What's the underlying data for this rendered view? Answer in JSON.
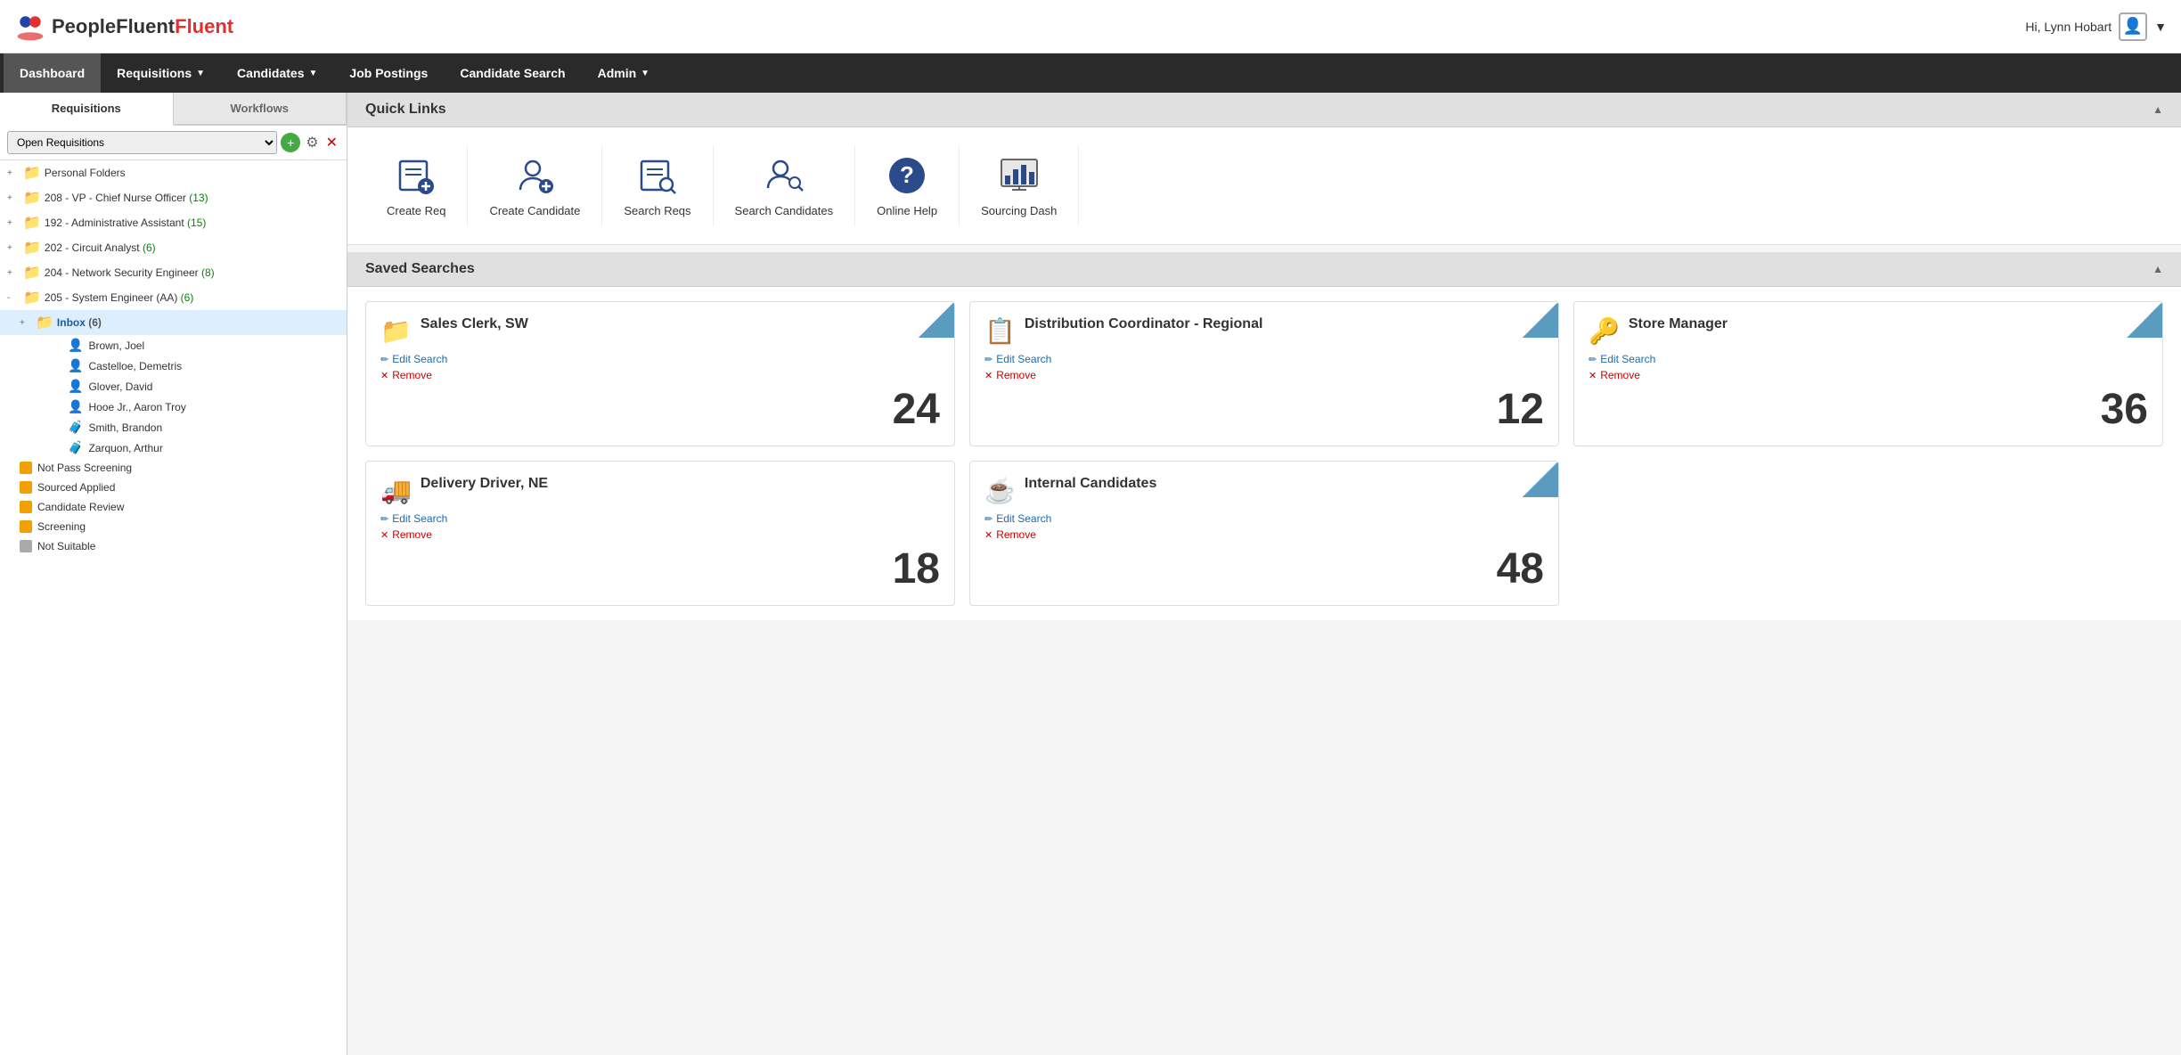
{
  "app": {
    "title": "PeopleFluent"
  },
  "topbar": {
    "logo_people": "People",
    "logo_fluent": "Fluent",
    "user_greeting": "Hi, Lynn Hobart"
  },
  "nav": {
    "items": [
      {
        "label": "Dashboard",
        "active": true,
        "has_arrow": false
      },
      {
        "label": "Requisitions",
        "active": false,
        "has_arrow": true
      },
      {
        "label": "Candidates",
        "active": false,
        "has_arrow": true
      },
      {
        "label": "Job Postings",
        "active": false,
        "has_arrow": false
      },
      {
        "label": "Candidate Search",
        "active": false,
        "has_arrow": false
      },
      {
        "label": "Admin",
        "active": false,
        "has_arrow": true
      }
    ]
  },
  "sidebar": {
    "tabs": [
      "Requisitions",
      "Workflows"
    ],
    "active_tab": "Requisitions",
    "dropdown_value": "Open Requisitions",
    "tree": [
      {
        "level": 0,
        "label": "Personal Folders",
        "icon": "folder_gray",
        "toggle": "+"
      },
      {
        "level": 0,
        "label": "208 - VP - Chief Nurse Officer",
        "count": "(13)",
        "count_color": "green",
        "icon": "folder_green",
        "toggle": "+"
      },
      {
        "level": 0,
        "label": "192 - Administrative Assistant",
        "count": "(15)",
        "count_color": "green",
        "icon": "folder_green",
        "toggle": "+"
      },
      {
        "level": 0,
        "label": "202 - Circuit Analyst",
        "count": "(6)",
        "count_color": "green",
        "icon": "folder_orange",
        "toggle": "+"
      },
      {
        "level": 0,
        "label": "204 - Network Security Engineer",
        "count": "(8)",
        "count_color": "green",
        "icon": "folder_purple",
        "toggle": "+"
      },
      {
        "level": 0,
        "label": "205 - System Engineer (AA)",
        "count": "(6)",
        "count_color": "green",
        "icon": "folder_green",
        "toggle": "-"
      }
    ],
    "inbox": {
      "label": "Inbox",
      "count": "(6)",
      "selected": true,
      "candidates": [
        "Brown, Joel",
        "Castelloe, Demetris",
        "Glover, David",
        "Hooe Jr., Aaron Troy",
        "Smith, Brandon",
        "Zarquon, Arthur"
      ]
    },
    "stages": [
      {
        "label": "Not Pass Screening",
        "color": "yellow"
      },
      {
        "label": "Sourced Applied",
        "color": "yellow"
      },
      {
        "label": "Candidate Review",
        "color": "yellow"
      },
      {
        "label": "Screening",
        "color": "yellow"
      },
      {
        "label": "Not Suitable",
        "color": "gray"
      }
    ]
  },
  "quick_links": {
    "section_title": "Quick Links",
    "items": [
      {
        "label": "Create Req",
        "icon": "create-req-icon"
      },
      {
        "label": "Create Candidate",
        "icon": "create-candidate-icon"
      },
      {
        "label": "Search Reqs",
        "icon": "search-reqs-icon"
      },
      {
        "label": "Search Candidates",
        "icon": "search-candidates-icon"
      },
      {
        "label": "Online Help",
        "icon": "online-help-icon"
      },
      {
        "label": "Sourcing Dash",
        "icon": "sourcing-dash-icon"
      }
    ]
  },
  "saved_searches": {
    "section_title": "Saved Searches",
    "cards": [
      {
        "title": "Sales Clerk, SW",
        "count": "24",
        "icon": "📁",
        "icon_color": "#3a8a3a",
        "edit_label": "Edit Search",
        "remove_label": "Remove"
      },
      {
        "title": "Distribution Coordinator - Regional",
        "count": "12",
        "icon": "📋",
        "icon_color": "#c8a800",
        "edit_label": "Edit Search",
        "remove_label": "Remove"
      },
      {
        "title": "Store Manager",
        "count": "36",
        "icon": "🔑",
        "icon_color": "#5050a0",
        "edit_label": "Edit Search",
        "remove_label": "Remove"
      },
      {
        "title": "Delivery Driver, NE",
        "count": "18",
        "icon": "🚚",
        "icon_color": "#444",
        "edit_label": "Edit Search",
        "remove_label": "Remove"
      },
      {
        "title": "Internal Candidates",
        "count": "48",
        "icon": "☕",
        "icon_color": "#c87800",
        "edit_label": "Edit Search",
        "remove_label": "Remove"
      }
    ]
  }
}
